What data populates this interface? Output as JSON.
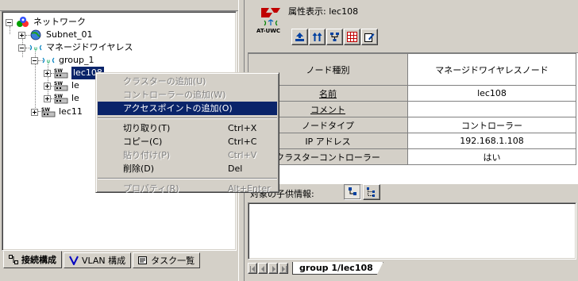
{
  "tree": {
    "root": {
      "label": "ネットワーク",
      "icon": "network-icon"
    },
    "subnet": {
      "label": "Subnet_01",
      "icon": "globe-icon"
    },
    "managed_wireless": {
      "label": "マネージドワイヤレス",
      "icon": "wireless-icon"
    },
    "group": {
      "label": "group_1",
      "icon": "wireless-icon"
    },
    "switches": [
      {
        "label": "lec108",
        "selected": true,
        "icon": "switch-icon"
      },
      {
        "label": "le",
        "icon": "switch-icon"
      },
      {
        "label": "le",
        "icon": "switch-icon"
      }
    ],
    "lec11": {
      "label": "lec11",
      "icon": "switch-icon"
    }
  },
  "left_tabs": [
    {
      "label": "接続構成",
      "icon": "topology-icon",
      "active": true
    },
    {
      "label": "VLAN 構成",
      "icon": "vlan-icon",
      "active": false
    },
    {
      "label": "タスク一覧",
      "icon": "task-list-icon",
      "active": false
    }
  ],
  "context_menu": {
    "items": [
      {
        "label": "クラスターの追加(U)",
        "shortcut": "",
        "state": "disabled"
      },
      {
        "label": "コントローラーの追加(W)",
        "shortcut": "",
        "state": "disabled"
      },
      {
        "label": "アクセスポイントの追加(O)",
        "shortcut": "",
        "state": "highlight"
      },
      {
        "label": "切り取り(T)",
        "shortcut": "Ctrl+X",
        "state": "enabled"
      },
      {
        "label": "コピー(C)",
        "shortcut": "Ctrl+C",
        "state": "enabled"
      },
      {
        "label": "貼り付け(P)",
        "shortcut": "Ctrl+V",
        "state": "disabled"
      },
      {
        "label": "削除(D)",
        "shortcut": "Del",
        "state": "enabled"
      },
      {
        "label": "プロパティ(R)",
        "shortcut": "Alt+Enter",
        "state": "disabled"
      }
    ]
  },
  "right": {
    "logo_text": "AT-UWC",
    "attr_title": "属性表示: lec108",
    "toolbar_icons": [
      "upload-icon",
      "transfer-icon",
      "network-map-icon",
      "grid-icon",
      "edit-icon"
    ],
    "table": {
      "header": {
        "key": "ノード種別",
        "value": "マネージドワイヤレスノード"
      },
      "rows": [
        {
          "key": "名前",
          "value": "lec108",
          "underline": true
        },
        {
          "key": "コメント",
          "value": "",
          "underline": true
        },
        {
          "key": "ノードタイプ",
          "value": "コントローラー",
          "underline": false
        },
        {
          "key": "IP アドレス",
          "value": "192.168.1.108",
          "underline": false
        },
        {
          "key": "クラスターコントローラー",
          "value": "はい",
          "underline": false
        }
      ]
    },
    "child_label": "対象の子供情報:",
    "child_view_icons": [
      "detail-view-icon",
      "tree-view-icon"
    ],
    "sheet_tab": "group 1/lec108"
  },
  "colors": {
    "face": "#d4d0c8",
    "highlight": "#0a246a",
    "shadow": "#808080"
  }
}
